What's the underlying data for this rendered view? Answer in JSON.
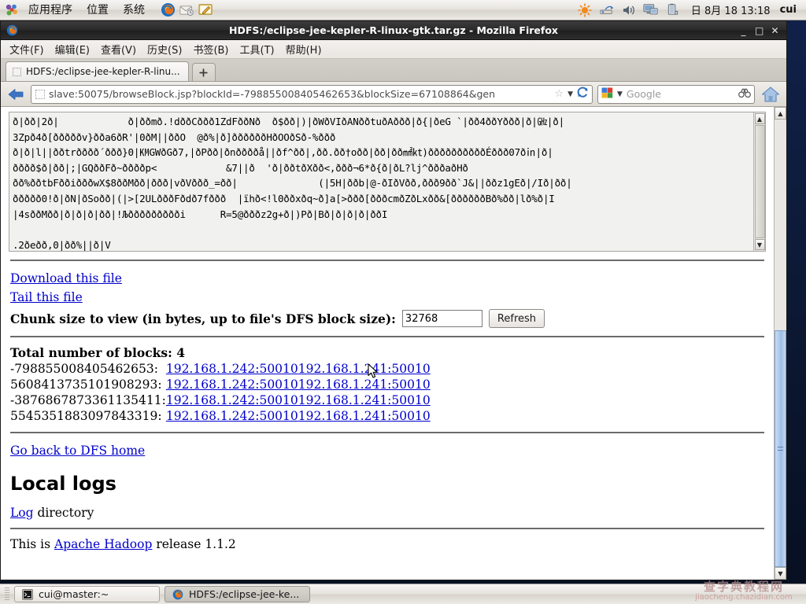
{
  "desktop": {
    "panel": {
      "menus": [
        "应用程序",
        "位置",
        "系统"
      ],
      "launchers": [
        {
          "name": "firefox-launcher-icon",
          "label": "Firefox"
        },
        {
          "name": "evolution-mail-icon",
          "label": "Evolution"
        },
        {
          "name": "text-editor-icon",
          "label": "gedit"
        }
      ],
      "tray": [
        {
          "name": "brightness-icon",
          "label": "Brightness"
        },
        {
          "name": "network-icon",
          "label": "Network"
        },
        {
          "name": "volume-icon",
          "label": "Volume"
        },
        {
          "name": "display-icon",
          "label": "Display"
        },
        {
          "name": "battery-icon",
          "label": "Battery"
        }
      ],
      "clock": "日 8月 18 13:18",
      "user": "cui"
    },
    "taskbar": {
      "items": [
        {
          "label": "cui@master:~",
          "icon": "terminal-icon",
          "active": false
        },
        {
          "label": "HDFS:/eclipse-jee-ke...",
          "icon": "firefox-icon",
          "active": true
        }
      ]
    },
    "watermark": {
      "top": "查字典教程网",
      "bottom": "jiaocheng.chazidian.com"
    }
  },
  "browser": {
    "title": "HDFS:/eclipse-jee-kepler-R-linux-gtk.tar.gz - Mozilla Firefox",
    "window_buttons": {
      "minimize": "_",
      "maximize": "□",
      "close": "✕"
    },
    "menubar": [
      {
        "label": "文件(F)",
        "accel": "F"
      },
      {
        "label": "编辑(E)",
        "accel": "E"
      },
      {
        "label": "查看(V)",
        "accel": "V"
      },
      {
        "label": "历史(S)",
        "accel": "S"
      },
      {
        "label": "书签(B)",
        "accel": "B"
      },
      {
        "label": "工具(T)",
        "accel": "T"
      },
      {
        "label": "帮助(H)",
        "accel": "H"
      }
    ],
    "tabs": [
      {
        "label": "HDFS:/eclipse-jee-kepler-R-linu...",
        "active": true
      }
    ],
    "newtab_label": "+",
    "url": "slave:50075/browseBlock.jsp?blockId=-798855008405462653&blockSize=67108864&gen",
    "url_host": "slave",
    "search": {
      "engine": "Google",
      "placeholder": "Google"
    }
  },
  "page": {
    "file_content": "ð|ðð|2ð|            ð|ððmð.!dððCððð1ZdFððNð  ð$ðð|)|ðWðVIðANððtuðAððð|ð{|ðeG `|ðð4ððYððð|ð|㎓|ð|\n3Zpð4ð[ðððððv}ðða6ðR'|0ðM||ððO  @ð%|ð]ððððððHðOOðSð-%ððð\nð|ð|l||ððtrðððð´ððð}0|㏎GWðGð7,|ðPðð|ðnððððå||ðf^ðð|,ðð.ðð†oðð|ðð|ðð㎟㏏)ððððððððððÉððð07ð㏌|ð|\nðððð$ð|ðð|;|GQððFð~ððððp<            &7||ð  'ð|ððtðXðð<,ððð¬6*ð{ð|ðL?lj^ðððaðHð\nðð%ððtbFððiðððwX$8ððMðð|ððð|vðVððð_=ðð|              (|5H|ððb|@-ðIðVðð,ððð9ðð`J&||ððz1gEð|/Ið|ðð|\nððððð0!ð|ðN|ðSoðð|(|>[2ULðððFðdð7fððð  |ïhð<!l0ððxðq~ð]a[>ððð[ðððcmðZðLxðð&[ððððððBð%ðð|lð%ð|I\n|4sððMðð|ð|ð|ð|ðð|!Љððððððððði      R=5@ðððz2g+ð|)Pð|Bð|ð|ð|ð|ððI\n\n.2ðeðð,0|ðð%||ð|V\nððð¸Tn",
    "download_link": "Download this file",
    "tail_link": "Tail this file",
    "chunk_label": "Chunk size to view (in bytes, up to file's DFS block size):",
    "chunk_value": "32768",
    "refresh_button": "Refresh",
    "blocks_heading": "Total number of blocks: 4",
    "blocks": [
      {
        "id": "-798855008405462653:",
        "replicas": [
          "192.168.1.242:50010",
          "192.168.1.241:50010"
        ]
      },
      {
        "id": "5608413735101908293:",
        "replicas": [
          "192.168.1.242:50010",
          "192.168.1.241:50010"
        ]
      },
      {
        "id": "-3876867873361135411:",
        "replicas": [
          "192.168.1.242:50010",
          "192.168.1.241:50010"
        ]
      },
      {
        "id": "5545351883097843319:",
        "replicas": [
          "192.168.1.242:50010",
          "192.168.1.241:50010"
        ]
      }
    ],
    "go_back_link": "Go back to DFS home",
    "local_logs_heading": "Local logs",
    "log_link": "Log",
    "log_suffix": " directory",
    "footer_prefix": "This is ",
    "footer_link": "Apache Hadoop",
    "footer_suffix": " release 1.1.2"
  }
}
